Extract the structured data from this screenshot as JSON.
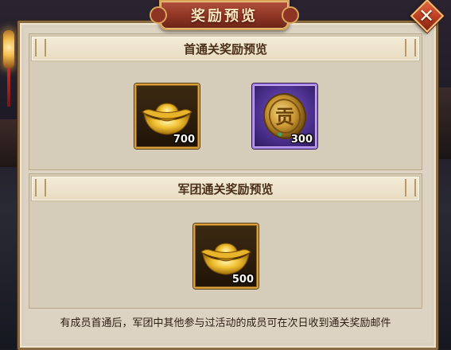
{
  "window": {
    "title": "奖励预览"
  },
  "sections": [
    {
      "heading": "首通关奖励预览",
      "rewards": [
        {
          "icon": "gold-ingot-icon",
          "quantity": "700",
          "frame": "gold"
        },
        {
          "icon": "contribution-coin-icon",
          "quantity": "300",
          "frame": "purple",
          "coin_glyph": "贡"
        }
      ]
    },
    {
      "heading": "军团通关奖励预览",
      "rewards": [
        {
          "icon": "gold-ingot-icon",
          "quantity": "500",
          "frame": "gold"
        }
      ]
    }
  ],
  "footer": {
    "note": "有成员首通后，军团中其他参与过活动的成员可在次日收到通关奖励邮件"
  },
  "colors": {
    "title_plate": "#8e3424",
    "gold_frame": "#d9a23d",
    "purple_frame": "#a988e8",
    "panel": "#d9d0c0"
  }
}
